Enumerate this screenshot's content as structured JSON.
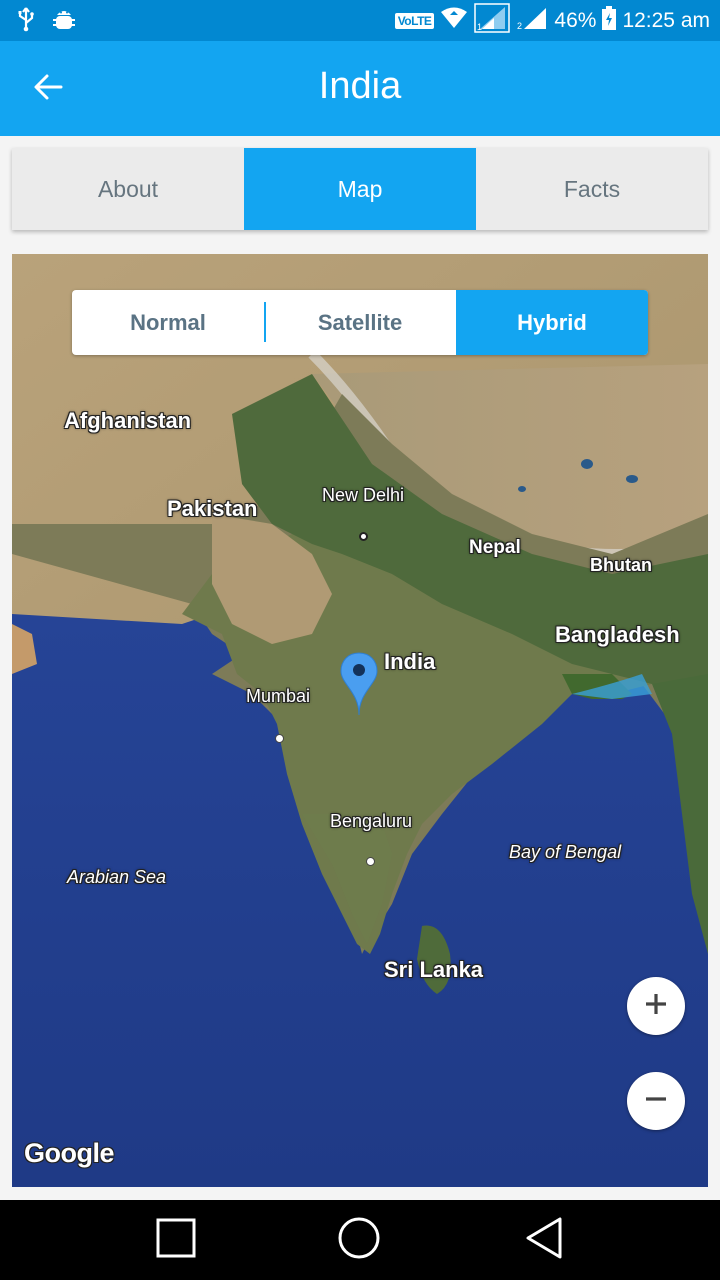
{
  "status_bar": {
    "left_icons": [
      "usb-icon",
      "android-debug-icon"
    ],
    "volte": "VoLTE",
    "right_icons": [
      "wifi-icon",
      "signal-sim1-icon",
      "signal-sim2-icon",
      "battery-charging-icon"
    ],
    "battery": "46%",
    "time": "12:25 am"
  },
  "app_bar": {
    "back_icon": "arrow-back-icon",
    "title": "India"
  },
  "tabs": [
    {
      "label": "About",
      "active": false
    },
    {
      "label": "Map",
      "active": true
    },
    {
      "label": "Facts",
      "active": false
    }
  ],
  "map": {
    "map_type_options": [
      {
        "label": "Normal",
        "active": false
      },
      {
        "label": "Satellite",
        "active": false
      },
      {
        "label": "Hybrid",
        "active": true
      }
    ],
    "labels": {
      "afghanistan": "Afghanistan",
      "pakistan": "Pakistan",
      "new_delhi": "New Delhi",
      "nepal": "Nepal",
      "bhutan": "Bhutan",
      "bangladesh": "Bangladesh",
      "india": "India",
      "mumbai": "Mumbai",
      "bengaluru": "Bengaluru",
      "bay_of_bengal": "Bay of Bengal",
      "arabian_sea": "Arabian Sea",
      "sri_lanka": "Sri Lanka"
    },
    "marker": {
      "label": "India",
      "color": "#4a9ef0"
    },
    "zoom_in": "+",
    "zoom_out": "−",
    "attribution": "Google"
  },
  "nav_bar": {
    "buttons": [
      "recents-icon",
      "home-icon",
      "back-triangle-icon"
    ]
  },
  "colors": {
    "primary": "#13a5f1",
    "status_bar": "#0288d1",
    "tab_inactive_bg": "#ebebeb",
    "tab_inactive_text": "#66757f"
  }
}
